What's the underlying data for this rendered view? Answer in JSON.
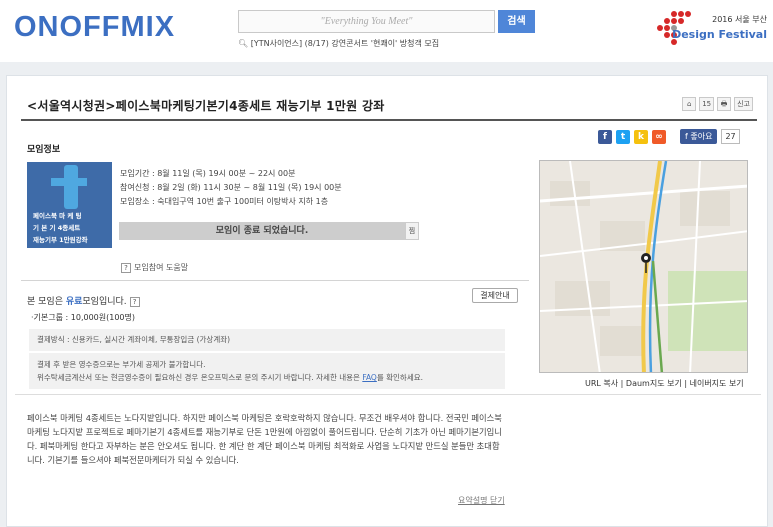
{
  "header": {
    "logo": "ONOFFMIX",
    "search_placeholder": "\"Everything You Meet\"",
    "search_button": "검색",
    "notice": "[YTN사이언스] (8/17) 강연콘서트 '현쾌이' 방청객 모집",
    "festival_year": "2016 서울 부산",
    "festival_name": "Design Festival"
  },
  "event": {
    "title": "<서울역시청권>페이스북마케팅기본기4종세트 재능기부 1만원 강좌",
    "tools": [
      "⌂",
      "15",
      "🖶",
      "신고"
    ],
    "section_title": "모임정보",
    "social": {
      "like_label": "좋아요",
      "like_count": "27"
    },
    "thumbnail": {
      "line1": "페이스북   마 케 팅",
      "line2": "기 본 기   4종세트",
      "line3": "재능기부    1만원강좌"
    },
    "period": "모임기간 : 8월 11일 (목) 19시 00분 ~ 22시 00분",
    "apply": "참여신청 : 8월 2일 (화) 11시 30분 ~ 8월 11일 (목) 19시 00분",
    "place": "모임장소 : 숙대입구역 10번 출구 100미터 이탕박사 지하 1층",
    "closed_label": "모임이 종료 되었습니다.",
    "zzim_label": "찜",
    "help_label": "모임참여 도움말",
    "paid_pre": "본 모임은 ",
    "paid_hl": "유료",
    "paid_post": "모임입니다.",
    "pay_guide_button": "결제안내",
    "fee": "·기본그룹 : 10,000원(100명)",
    "pay_methods": "결제방식 : 신용카드, 실시간 계좌이체, 무통장입금 (가상계좌)",
    "receipt_line1": "결제 후 받은 영수증으로는 부가세 공제가 불가합니다.",
    "receipt_line2": "위수탁세금계산서 또는 현금영수증이 필요하신 경우 온오프믹스로 문의 주시기 바랍니다. 자세한 내용은 ",
    "faq_link": "FAQ",
    "receipt_line2_post": "를 확인하세요.",
    "map_links": "URL 복사  |  Daum지도 보기  |  네이버지도 보기",
    "description": "페이스북 마케팅 4종세트는 노다지밭입니다. 하지만 페이스북 마케팅은 호락호락하지 않습니다. 무조건 배우셔야 합니다. 전국민 페이스북 마케팅 노다지밭 프로젝트로 페마기본기 4종세트를 재능기부로 단돈 1만원에 아낌없이 풀어드립니다. 단순히 기초가 아닌 페마기본기입니다. 페북마케팅 한다고 자부하는 분은 안오셔도 됩니다. 한 계단 한 계단 페이스북 마케팅 최적화로 사업을 노다지밭 만드실 분들만 초대합니다. 기본기를 들으셔야 페북전문마케터가 되실 수 있습니다.",
    "summary_link": "요약설명 닫기"
  },
  "colors": {
    "brand": "#3c6fc2",
    "button": "#4f86d8",
    "festival_red": "#d62828"
  }
}
